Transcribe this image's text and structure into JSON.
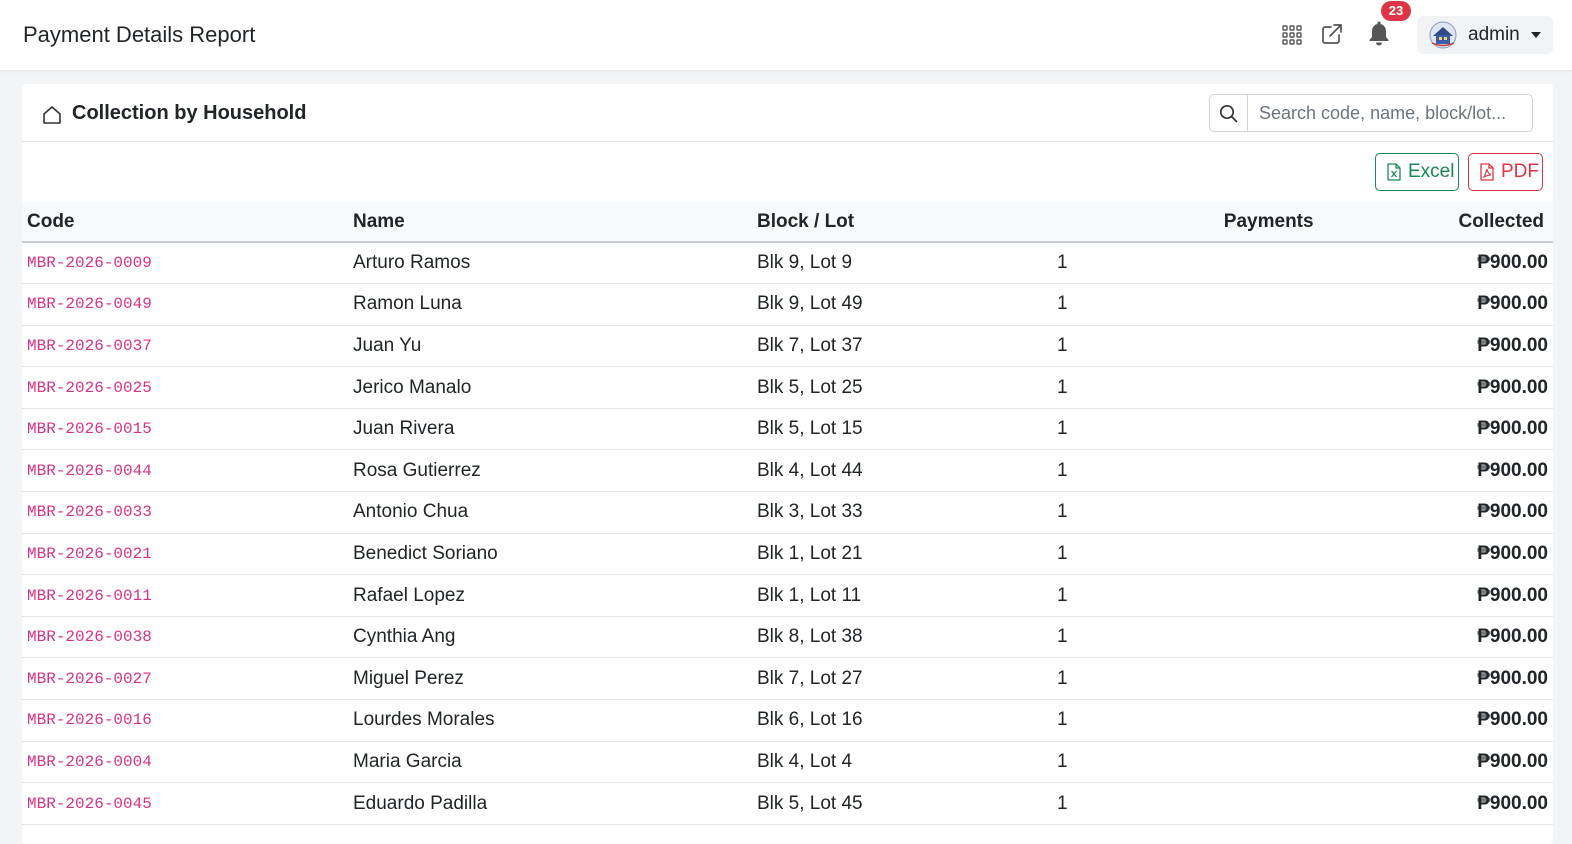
{
  "header": {
    "title": "Payment Details Report",
    "notification_count": "23",
    "user_name": "admin",
    "icons": [
      "apps-grid-icon",
      "external-link-icon",
      "bell-icon",
      "avatar"
    ]
  },
  "card": {
    "title": "Collection by Household",
    "search_placeholder": "Search code, name, block/lot...",
    "excel_label": "Excel",
    "pdf_label": "PDF"
  },
  "table": {
    "columns": [
      "Code",
      "Name",
      "Block / Lot",
      "Payments",
      "Collected"
    ],
    "rows": [
      {
        "code": "MBR-2026-0009",
        "name": "Arturo Ramos",
        "block_lot": "Blk 9, Lot 9",
        "payments": "1",
        "collected": "₱900.00"
      },
      {
        "code": "MBR-2026-0049",
        "name": "Ramon Luna",
        "block_lot": "Blk 9, Lot 49",
        "payments": "1",
        "collected": "₱900.00"
      },
      {
        "code": "MBR-2026-0037",
        "name": "Juan Yu",
        "block_lot": "Blk 7, Lot 37",
        "payments": "1",
        "collected": "₱900.00"
      },
      {
        "code": "MBR-2026-0025",
        "name": "Jerico Manalo",
        "block_lot": "Blk 5, Lot 25",
        "payments": "1",
        "collected": "₱900.00"
      },
      {
        "code": "MBR-2026-0015",
        "name": "Juan Rivera",
        "block_lot": "Blk 5, Lot 15",
        "payments": "1",
        "collected": "₱900.00"
      },
      {
        "code": "MBR-2026-0044",
        "name": "Rosa Gutierrez",
        "block_lot": "Blk 4, Lot 44",
        "payments": "1",
        "collected": "₱900.00"
      },
      {
        "code": "MBR-2026-0033",
        "name": "Antonio Chua",
        "block_lot": "Blk 3, Lot 33",
        "payments": "1",
        "collected": "₱900.00"
      },
      {
        "code": "MBR-2026-0021",
        "name": "Benedict Soriano",
        "block_lot": "Blk 1, Lot 21",
        "payments": "1",
        "collected": "₱900.00"
      },
      {
        "code": "MBR-2026-0011",
        "name": "Rafael Lopez",
        "block_lot": "Blk 1, Lot 11",
        "payments": "1",
        "collected": "₱900.00"
      },
      {
        "code": "MBR-2026-0038",
        "name": "Cynthia Ang",
        "block_lot": "Blk 8, Lot 38",
        "payments": "1",
        "collected": "₱900.00"
      },
      {
        "code": "MBR-2026-0027",
        "name": "Miguel Perez",
        "block_lot": "Blk 7, Lot 27",
        "payments": "1",
        "collected": "₱900.00"
      },
      {
        "code": "MBR-2026-0016",
        "name": "Lourdes Morales",
        "block_lot": "Blk 6, Lot 16",
        "payments": "1",
        "collected": "₱900.00"
      },
      {
        "code": "MBR-2026-0004",
        "name": "Maria Garcia",
        "block_lot": "Blk 4, Lot 4",
        "payments": "1",
        "collected": "₱900.00"
      },
      {
        "code": "MBR-2026-0045",
        "name": "Eduardo Padilla",
        "block_lot": "Blk 5, Lot 45",
        "payments": "1",
        "collected": "₱900.00"
      }
    ]
  },
  "colors": {
    "code_text": "#d63384",
    "excel": "#198754",
    "pdf": "#dc3545",
    "badge": "#dc3545"
  }
}
